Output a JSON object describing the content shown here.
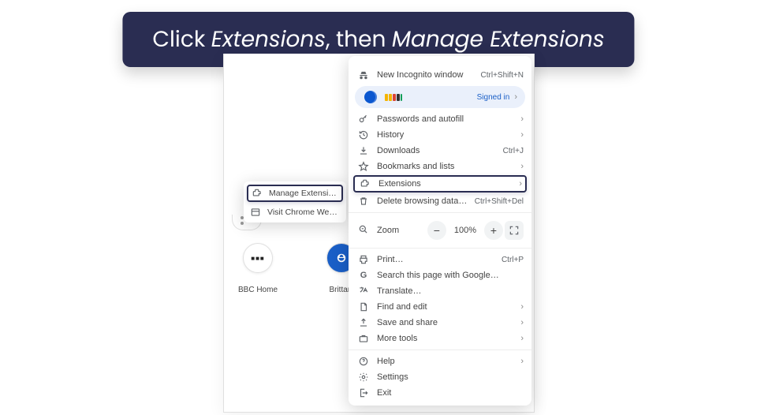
{
  "banner": {
    "pre": "Click ",
    "em1": "Extensions",
    "mid": ", then ",
    "em2": "Manage Extensions"
  },
  "menu": {
    "incognito": {
      "label": "New Incognito window",
      "shortcut": "Ctrl+Shift+N"
    },
    "profile": {
      "status": "Signed in"
    },
    "passwords": {
      "label": "Passwords and autofill"
    },
    "history": {
      "label": "History"
    },
    "downloads": {
      "label": "Downloads",
      "shortcut": "Ctrl+J"
    },
    "bookmarks": {
      "label": "Bookmarks and lists"
    },
    "extensions": {
      "label": "Extensions"
    },
    "delete": {
      "label": "Delete browsing data…",
      "shortcut": "Ctrl+Shift+Del"
    },
    "zoom": {
      "label": "Zoom",
      "value": "100%"
    },
    "print": {
      "label": "Print…",
      "shortcut": "Ctrl+P"
    },
    "search": {
      "label": "Search this page with Google…"
    },
    "translate": {
      "label": "Translate…"
    },
    "find": {
      "label": "Find and edit"
    },
    "save": {
      "label": "Save and share"
    },
    "more": {
      "label": "More tools"
    },
    "help": {
      "label": "Help"
    },
    "settings": {
      "label": "Settings"
    },
    "exit": {
      "label": "Exit"
    }
  },
  "submenu": {
    "manage": {
      "label": "Manage Extensions"
    },
    "store": {
      "label": "Visit Chrome Web Store"
    }
  },
  "shortcuts": {
    "bbc": "BBC Home",
    "brit": "Brittani"
  }
}
